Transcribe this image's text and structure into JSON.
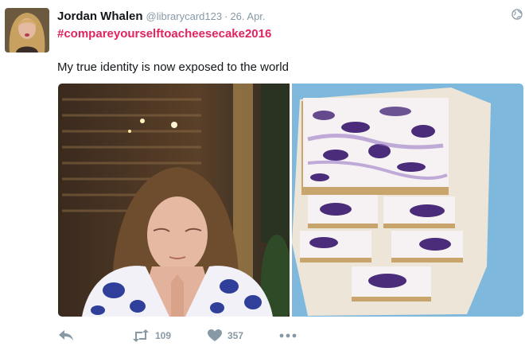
{
  "tweet": {
    "author_name": "Jordan Whalen",
    "handle": "@librarycard123",
    "separator": "·",
    "date": "26. Apr.",
    "hashtag": "#compareyourselftoacheesecake2016",
    "text": "My true identity is now exposed to the world"
  },
  "actions": {
    "retweet_count": "109",
    "like_count": "357"
  },
  "colors": {
    "hashtag": "#e0245e",
    "muted": "#8899a6",
    "text": "#14171a",
    "plate_blue": "#7fb8dd"
  }
}
